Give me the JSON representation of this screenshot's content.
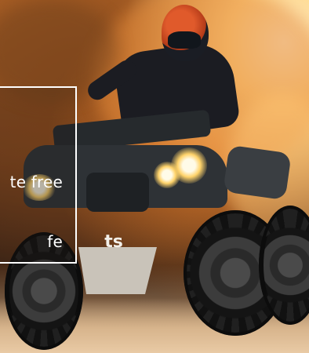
{
  "hero": {
    "image_icon": "atv-rider-photo",
    "brand_mark": "ts",
    "accent_colors": {
      "dust": "#d9792a",
      "sun": "#fff4d6",
      "frame": "#ffffff"
    }
  },
  "promo": {
    "line_1": "te free",
    "line_2": "fe"
  }
}
